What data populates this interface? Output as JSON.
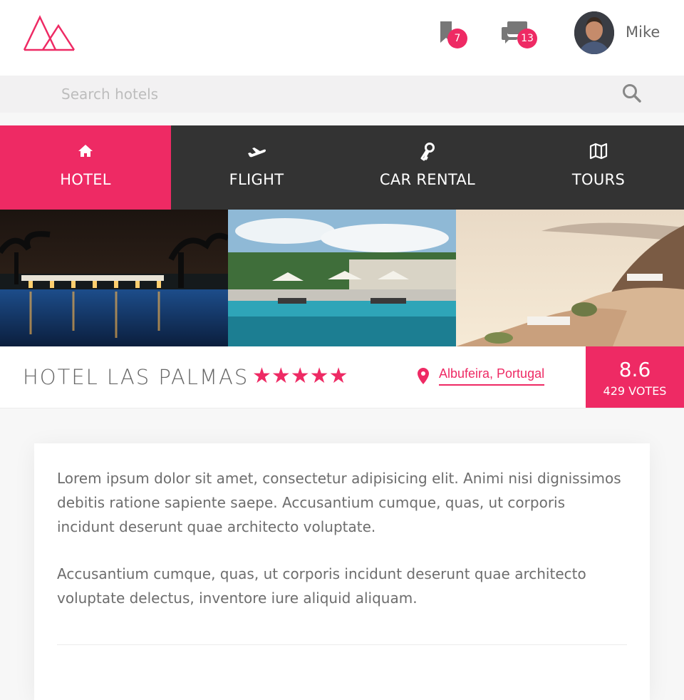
{
  "header": {
    "logo_icon": "mountains-logo",
    "bookmark_count": "7",
    "message_count": "13",
    "user_name": "Mike"
  },
  "search": {
    "placeholder": "Search hotels",
    "value": ""
  },
  "nav": {
    "items": [
      {
        "label": "HOTEL",
        "icon": "home-icon",
        "active": true
      },
      {
        "label": "FLIGHT",
        "icon": "plane-icon",
        "active": false
      },
      {
        "label": "CAR RENTAL",
        "icon": "key-icon",
        "active": false
      },
      {
        "label": "TOURS",
        "icon": "map-icon",
        "active": false
      }
    ]
  },
  "hotel": {
    "name": "HOTEL LAS PALMAS",
    "stars": "★★★★★",
    "location": "Albufeira, Portugal",
    "score": "8.6",
    "votes": "429 VOTES"
  },
  "description": {
    "paragraph1": "Lorem ipsum dolor sit amet, consectetur adipisicing elit. Animi nisi dignissimos debitis ratione sapiente saepe. Accusantium cumque, quas, ut corporis incidunt deserunt quae architecto voluptate.",
    "paragraph2": "Accusantium cumque, quas, ut corporis incidunt deserunt quae architecto voluptate delectus, inventore iure aliquid aliquam."
  },
  "colors": {
    "accent": "#ee2a64",
    "nav_background": "#333333"
  }
}
